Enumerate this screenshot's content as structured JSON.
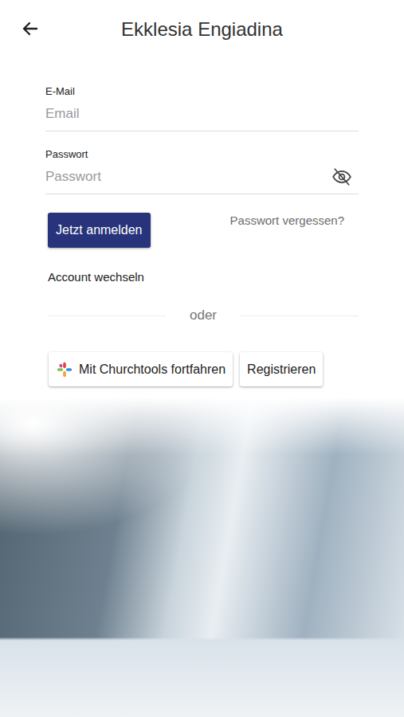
{
  "header": {
    "title": "Ekklesia Engiadina"
  },
  "fields": [
    {
      "label": "E-Mail",
      "placeholder": "Email",
      "kind": "text"
    },
    {
      "label": "Passwort",
      "placeholder": "Passwort",
      "kind": "password",
      "visible": false
    }
  ],
  "login_button": "Jetzt anmelden",
  "forgot_link": "Passwort vergessen?",
  "switch_account": "Account wechseln",
  "divider": "oder",
  "alt_buttons": [
    {
      "label": "Mit Churchtools fortfahren",
      "kind": "churchtools"
    },
    {
      "label": "Registrieren",
      "kind": "plain"
    }
  ]
}
